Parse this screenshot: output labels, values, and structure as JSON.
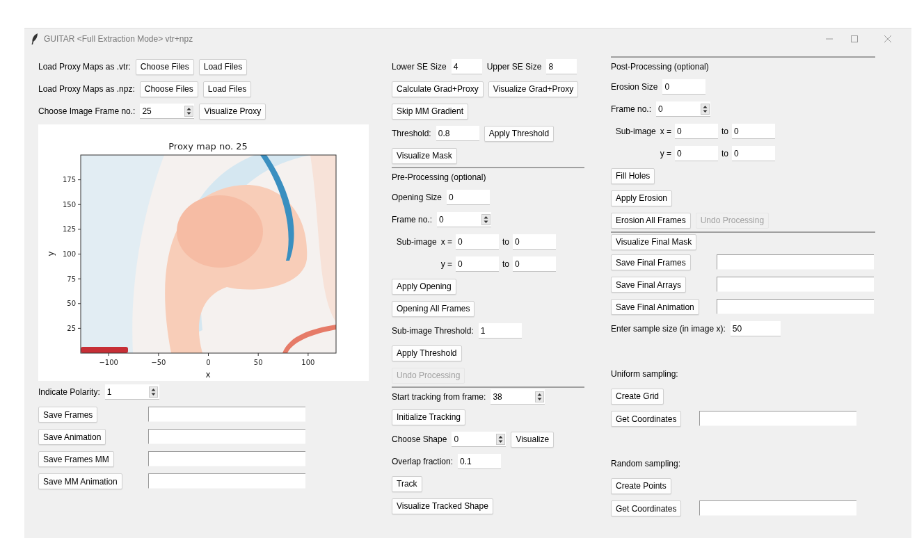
{
  "window": {
    "title": "GUITAR <Full Extraction Mode> vtr+npz"
  },
  "columns": [
    {
      "rows": [
        {
          "kind": "form",
          "items": [
            {
              "kind": "label",
              "text": "Load Proxy Maps as .vtr:"
            },
            {
              "kind": "button",
              "text": "Choose Files",
              "disabled": false
            },
            {
              "kind": "button",
              "text": "Load Files",
              "disabled": false
            }
          ]
        },
        {
          "kind": "form",
          "items": [
            {
              "kind": "label",
              "text": "Load Proxy Maps as .npz:"
            },
            {
              "kind": "button",
              "text": "Choose Files",
              "disabled": false
            },
            {
              "kind": "button",
              "text": "Load Files",
              "disabled": false
            }
          ]
        },
        {
          "kind": "form",
          "items": [
            {
              "kind": "label",
              "text": "Choose Image Frame no.:"
            },
            {
              "kind": "spinbox",
              "value": "25"
            },
            {
              "kind": "button",
              "text": "Visualize Proxy",
              "disabled": false
            }
          ]
        },
        {
          "kind": "plot",
          "plot": {
            "title": "Proxy map no. 25",
            "xlabel": "x",
            "ylabel": "y",
            "xticks": [
              "−100",
              "−50",
              "0",
              "50",
              "100"
            ],
            "yticks": [
              "175",
              "150",
              "125",
              "100",
              "75",
              "50",
              "25"
            ]
          }
        },
        {
          "kind": "form",
          "items": [
            {
              "kind": "label",
              "text": "Indicate Polarity:"
            },
            {
              "kind": "spinbox",
              "value": "1"
            }
          ]
        },
        {
          "kind": "file",
          "items": [
            {
              "kind": "button",
              "text": "Save Frames",
              "disabled": false
            },
            {
              "kind": "entry"
            }
          ]
        },
        {
          "kind": "file",
          "items": [
            {
              "kind": "button",
              "text": "Save Animation",
              "disabled": false
            },
            {
              "kind": "entry"
            }
          ]
        },
        {
          "kind": "file",
          "items": [
            {
              "kind": "button",
              "text": "Save Frames MM",
              "disabled": false
            },
            {
              "kind": "entry"
            }
          ]
        },
        {
          "kind": "file",
          "items": [
            {
              "kind": "button",
              "text": "Save MM Animation",
              "disabled": false
            },
            {
              "kind": "entry"
            }
          ]
        }
      ]
    },
    {
      "rows": [
        {
          "kind": "pair",
          "items": [
            {
              "kind": "label",
              "text": "Lower SE Size"
            },
            {
              "kind": "entry",
              "value": "4"
            },
            {
              "kind": "label",
              "text": "Upper SE Size"
            },
            {
              "kind": "entry",
              "value": "8"
            }
          ]
        },
        {
          "kind": "form",
          "items": [
            {
              "kind": "button",
              "text": "Calculate Grad+Proxy",
              "disabled": false
            },
            {
              "kind": "button",
              "text": "Visualize Grad+Proxy",
              "disabled": false
            }
          ]
        },
        {
          "kind": "form",
          "items": [
            {
              "kind": "button",
              "text": "Skip MM Gradient",
              "disabled": false
            }
          ]
        },
        {
          "kind": "form",
          "items": [
            {
              "kind": "label",
              "text": "Threshold:"
            },
            {
              "kind": "entry",
              "value": "0.8"
            },
            {
              "kind": "button",
              "text": "Apply Threshold",
              "disabled": false
            }
          ]
        },
        {
          "kind": "form",
          "items": [
            {
              "kind": "button",
              "text": "Visualize Mask",
              "disabled": false
            }
          ]
        },
        {
          "kind": "separator"
        },
        {
          "kind": "heading",
          "items": [
            {
              "kind": "label",
              "text": "Pre-Processing (optional)"
            }
          ]
        },
        {
          "kind": "form",
          "items": [
            {
              "kind": "label",
              "text": "Opening Size"
            },
            {
              "kind": "entry",
              "value": "0"
            }
          ]
        },
        {
          "kind": "form",
          "items": [
            {
              "kind": "label",
              "text": "Frame no.:"
            },
            {
              "kind": "spinbox",
              "value": "0"
            }
          ]
        },
        {
          "kind": "range",
          "items": [
            {
              "kind": "label",
              "text": "Sub-image"
            },
            {
              "kind": "label",
              "text": "x ="
            },
            {
              "kind": "entry",
              "value": "0"
            },
            {
              "kind": "label",
              "text": "to"
            },
            {
              "kind": "entry",
              "value": "0"
            }
          ]
        },
        {
          "kind": "range",
          "items": [
            {
              "kind": "label",
              "text": "y ="
            },
            {
              "kind": "entry",
              "value": "0"
            },
            {
              "kind": "label",
              "text": "to"
            },
            {
              "kind": "entry",
              "value": "0"
            }
          ]
        },
        {
          "kind": "form",
          "items": [
            {
              "kind": "button",
              "text": "Apply Opening",
              "disabled": false
            }
          ]
        },
        {
          "kind": "form",
          "items": [
            {
              "kind": "button",
              "text": "Opening All Frames",
              "disabled": false
            }
          ]
        },
        {
          "kind": "form",
          "items": [
            {
              "kind": "label",
              "text": "Sub-image Threshold:"
            },
            {
              "kind": "entry",
              "value": "1"
            }
          ]
        },
        {
          "kind": "form",
          "items": [
            {
              "kind": "button",
              "text": "Apply Threshold",
              "disabled": false
            }
          ]
        },
        {
          "kind": "form",
          "items": [
            {
              "kind": "button",
              "text": "Undo Processing",
              "disabled": true
            }
          ]
        },
        {
          "kind": "separator"
        },
        {
          "kind": "form",
          "items": [
            {
              "kind": "label",
              "text": "Start tracking from frame:"
            },
            {
              "kind": "spinbox",
              "value": "38"
            }
          ]
        },
        {
          "kind": "form",
          "items": [
            {
              "kind": "button",
              "text": "Initialize Tracking",
              "disabled": false
            }
          ]
        },
        {
          "kind": "form",
          "items": [
            {
              "kind": "label",
              "text": "Choose Shape"
            },
            {
              "kind": "spinbox",
              "value": "0"
            },
            {
              "kind": "button",
              "text": "Visualize",
              "disabled": false
            }
          ]
        },
        {
          "kind": "form",
          "items": [
            {
              "kind": "label",
              "text": "Overlap fraction:"
            },
            {
              "kind": "entry",
              "value": "0.1"
            }
          ]
        },
        {
          "kind": "form",
          "items": [
            {
              "kind": "button",
              "text": "Track",
              "disabled": false
            }
          ]
        },
        {
          "kind": "form",
          "items": [
            {
              "kind": "button",
              "text": "Visualize Tracked Shape",
              "disabled": false
            }
          ]
        }
      ]
    },
    {
      "rows": [
        {
          "kind": "separator"
        },
        {
          "kind": "heading",
          "items": [
            {
              "kind": "label",
              "text": "Post-Processing (optional)"
            }
          ]
        },
        {
          "kind": "form",
          "items": [
            {
              "kind": "label",
              "text": "Erosion Size"
            },
            {
              "kind": "entry",
              "value": "0"
            }
          ]
        },
        {
          "kind": "form",
          "items": [
            {
              "kind": "label",
              "text": "Frame no.:"
            },
            {
              "kind": "spinbox",
              "value": "0"
            }
          ]
        },
        {
          "kind": "range",
          "items": [
            {
              "kind": "label",
              "text": "Sub-image"
            },
            {
              "kind": "label",
              "text": "x ="
            },
            {
              "kind": "entry",
              "value": "0"
            },
            {
              "kind": "label",
              "text": "to"
            },
            {
              "kind": "entry",
              "value": "0"
            }
          ]
        },
        {
          "kind": "range",
          "items": [
            {
              "kind": "label",
              "text": "y ="
            },
            {
              "kind": "entry",
              "value": "0"
            },
            {
              "kind": "label",
              "text": "to"
            },
            {
              "kind": "entry",
              "value": "0"
            }
          ]
        },
        {
          "kind": "form",
          "items": [
            {
              "kind": "button",
              "text": "Fill Holes",
              "disabled": false
            }
          ]
        },
        {
          "kind": "form",
          "items": [
            {
              "kind": "button",
              "text": "Apply Erosion",
              "disabled": false
            }
          ]
        },
        {
          "kind": "form",
          "items": [
            {
              "kind": "button",
              "text": "Erosion All Frames",
              "disabled": false
            },
            {
              "kind": "button",
              "text": "Undo Processing",
              "disabled": true
            }
          ]
        },
        {
          "kind": "separator"
        },
        {
          "kind": "form",
          "items": [
            {
              "kind": "button",
              "text": "Visualize Final Mask",
              "disabled": false
            }
          ]
        },
        {
          "kind": "file",
          "items": [
            {
              "kind": "button",
              "text": "Save Final Frames",
              "disabled": false
            },
            {
              "kind": "entry"
            }
          ]
        },
        {
          "kind": "file",
          "items": [
            {
              "kind": "button",
              "text": "Save Final Arrays",
              "disabled": false
            },
            {
              "kind": "entry"
            }
          ]
        },
        {
          "kind": "file",
          "items": [
            {
              "kind": "button",
              "text": "Save Final Animation",
              "disabled": false
            },
            {
              "kind": "entry"
            }
          ]
        },
        {
          "kind": "wide",
          "items": [
            {
              "kind": "label",
              "text": "Enter sample size (in image x):"
            },
            {
              "kind": "entry",
              "value": "50"
            }
          ]
        },
        {
          "kind": "caption",
          "items": [
            {
              "kind": "label",
              "text": "Uniform sampling:"
            }
          ]
        },
        {
          "kind": "form",
          "items": [
            {
              "kind": "button",
              "text": "Create Grid",
              "disabled": false
            }
          ]
        },
        {
          "kind": "coords",
          "items": [
            {
              "kind": "button",
              "text": "Get Coordinates",
              "disabled": false
            },
            {
              "kind": "entry"
            }
          ]
        },
        {
          "kind": "caption",
          "items": [
            {
              "kind": "label",
              "text": "Random sampling:"
            }
          ]
        },
        {
          "kind": "form",
          "items": [
            {
              "kind": "button",
              "text": "Create Points",
              "disabled": false
            }
          ]
        },
        {
          "kind": "coords",
          "items": [
            {
              "kind": "button",
              "text": "Get Coordinates",
              "disabled": false
            },
            {
              "kind": "entry"
            }
          ]
        }
      ]
    }
  ]
}
